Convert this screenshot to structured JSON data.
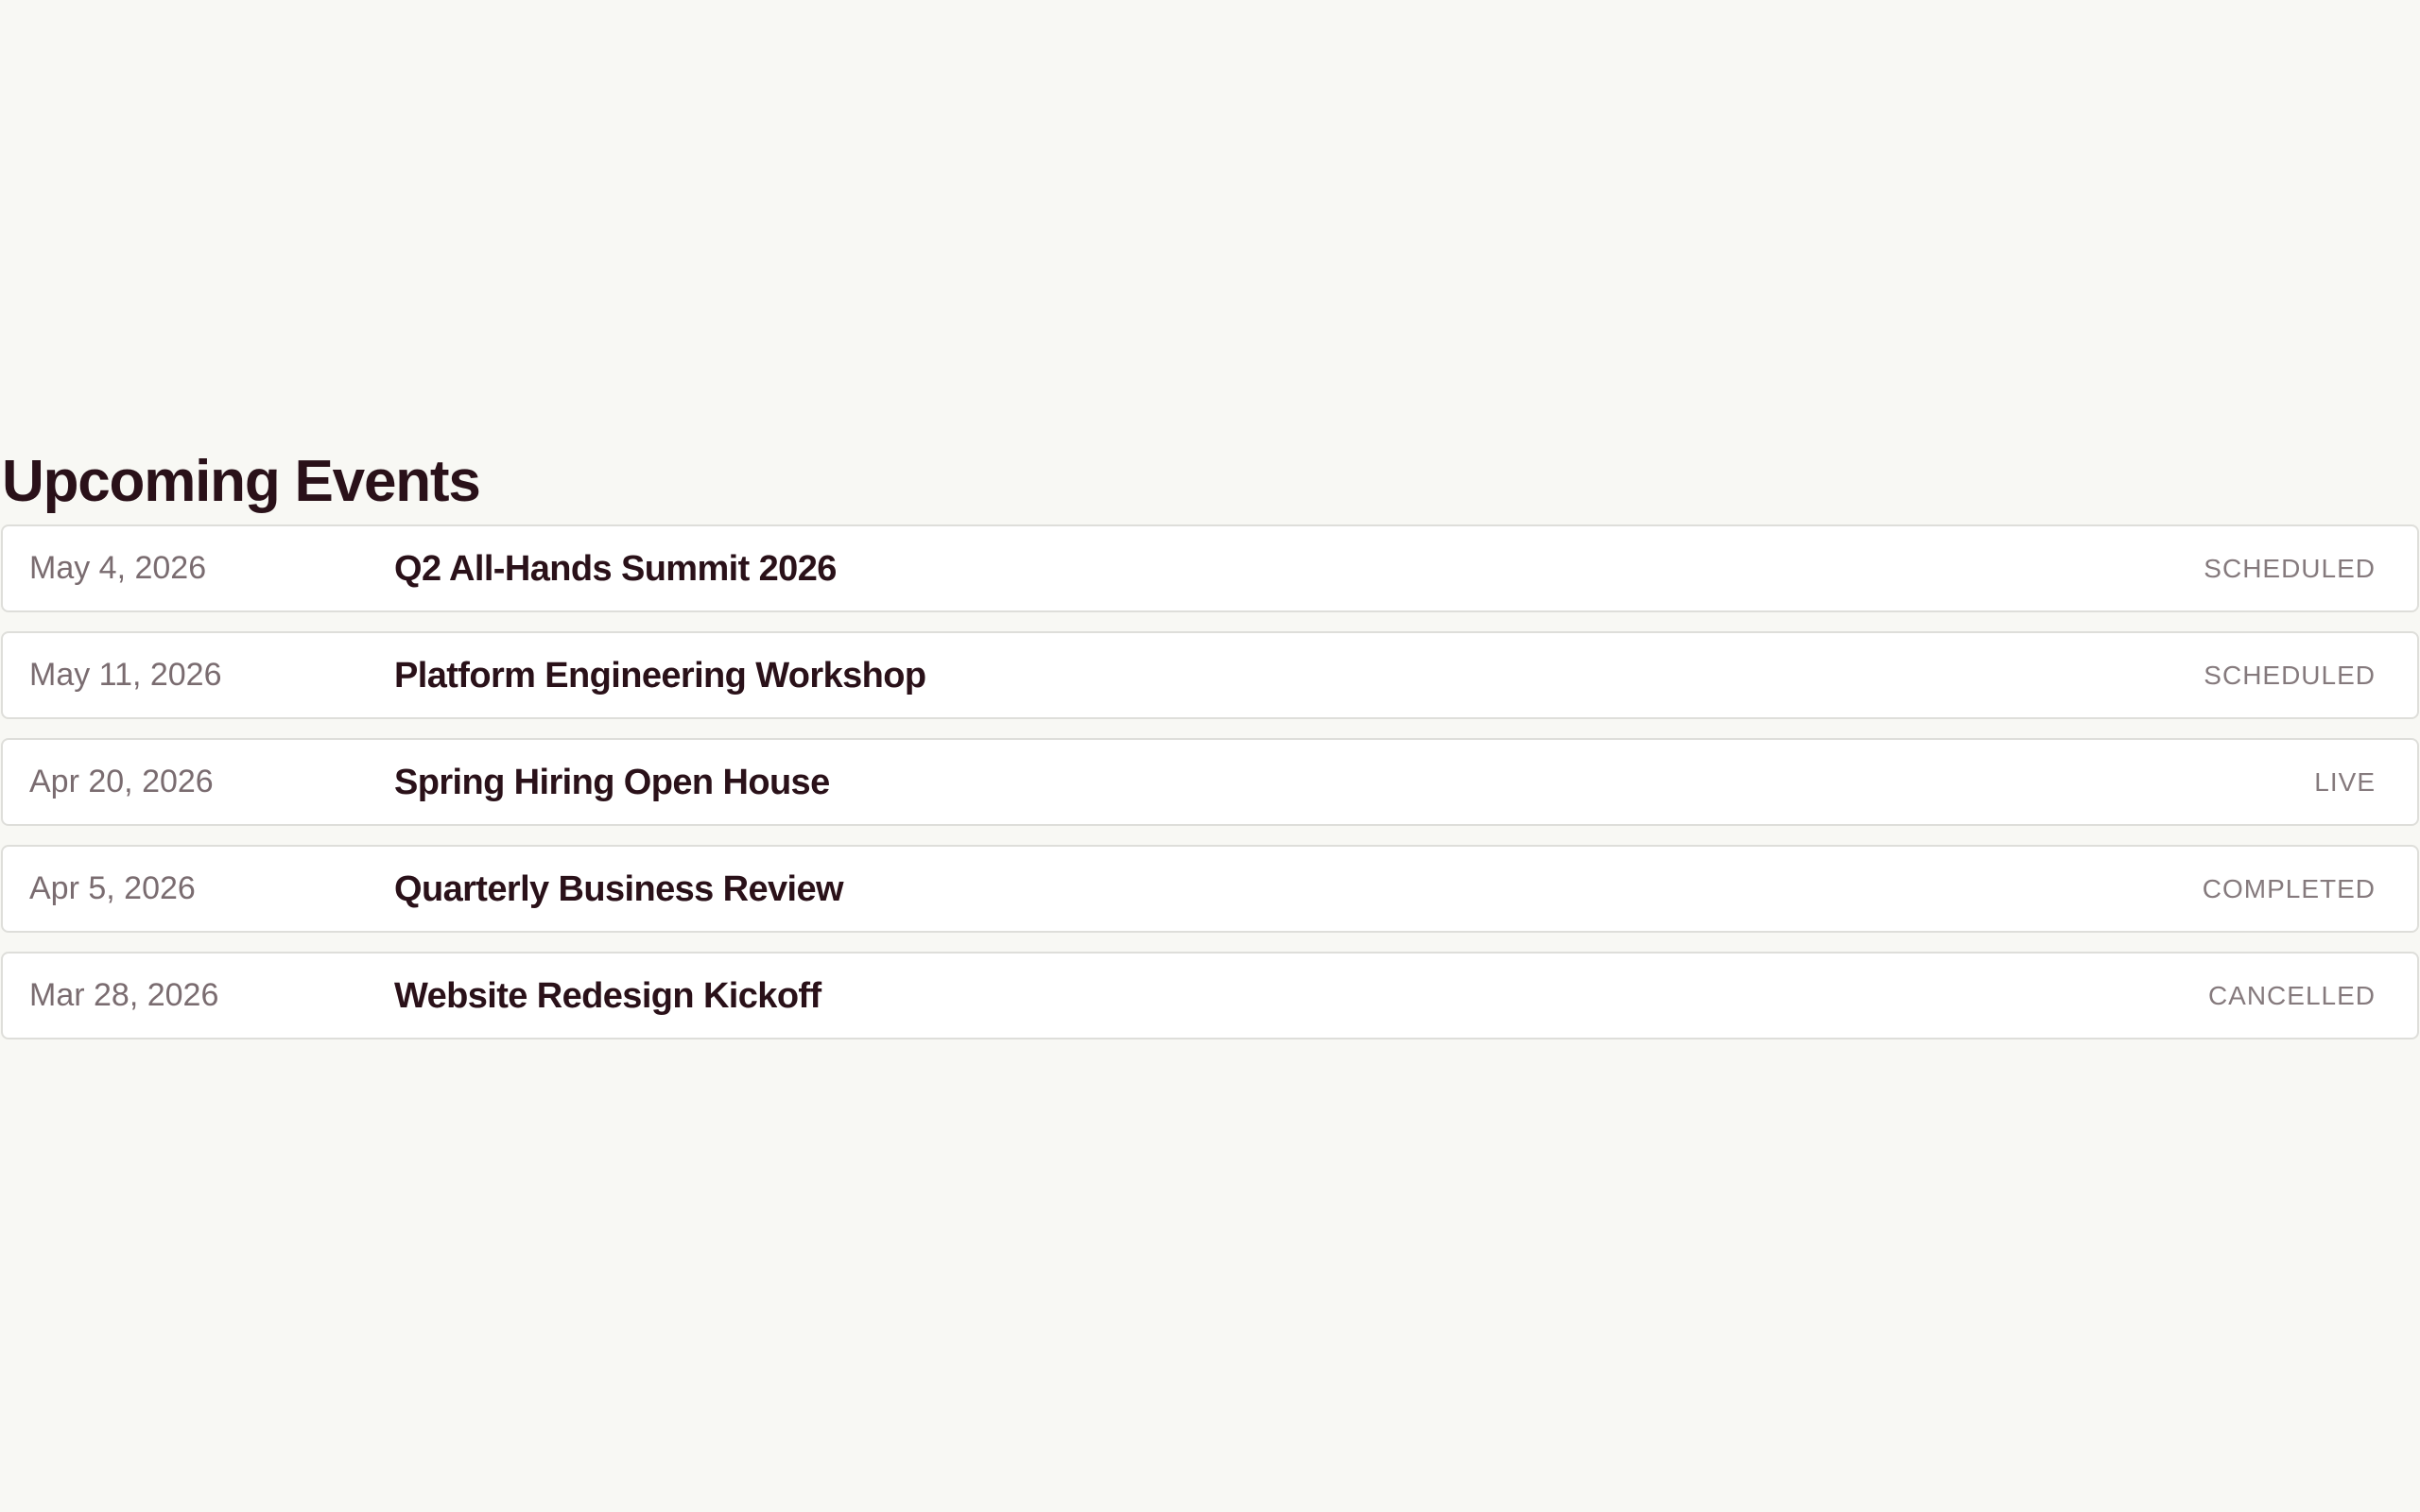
{
  "section": {
    "title": "Upcoming Events"
  },
  "events": [
    {
      "date": "May 4, 2026",
      "name": "Q2 All-Hands Summit 2026",
      "status": "SCHEDULED"
    },
    {
      "date": "May 11, 2026",
      "name": "Platform Engineering Workshop",
      "status": "SCHEDULED"
    },
    {
      "date": "Apr 20, 2026",
      "name": "Spring Hiring Open House",
      "status": "LIVE"
    },
    {
      "date": "Apr 5, 2026",
      "name": "Quarterly Business Review",
      "status": "COMPLETED"
    },
    {
      "date": "Mar 28, 2026",
      "name": "Website Redesign Kickoff",
      "status": "CANCELLED"
    }
  ]
}
